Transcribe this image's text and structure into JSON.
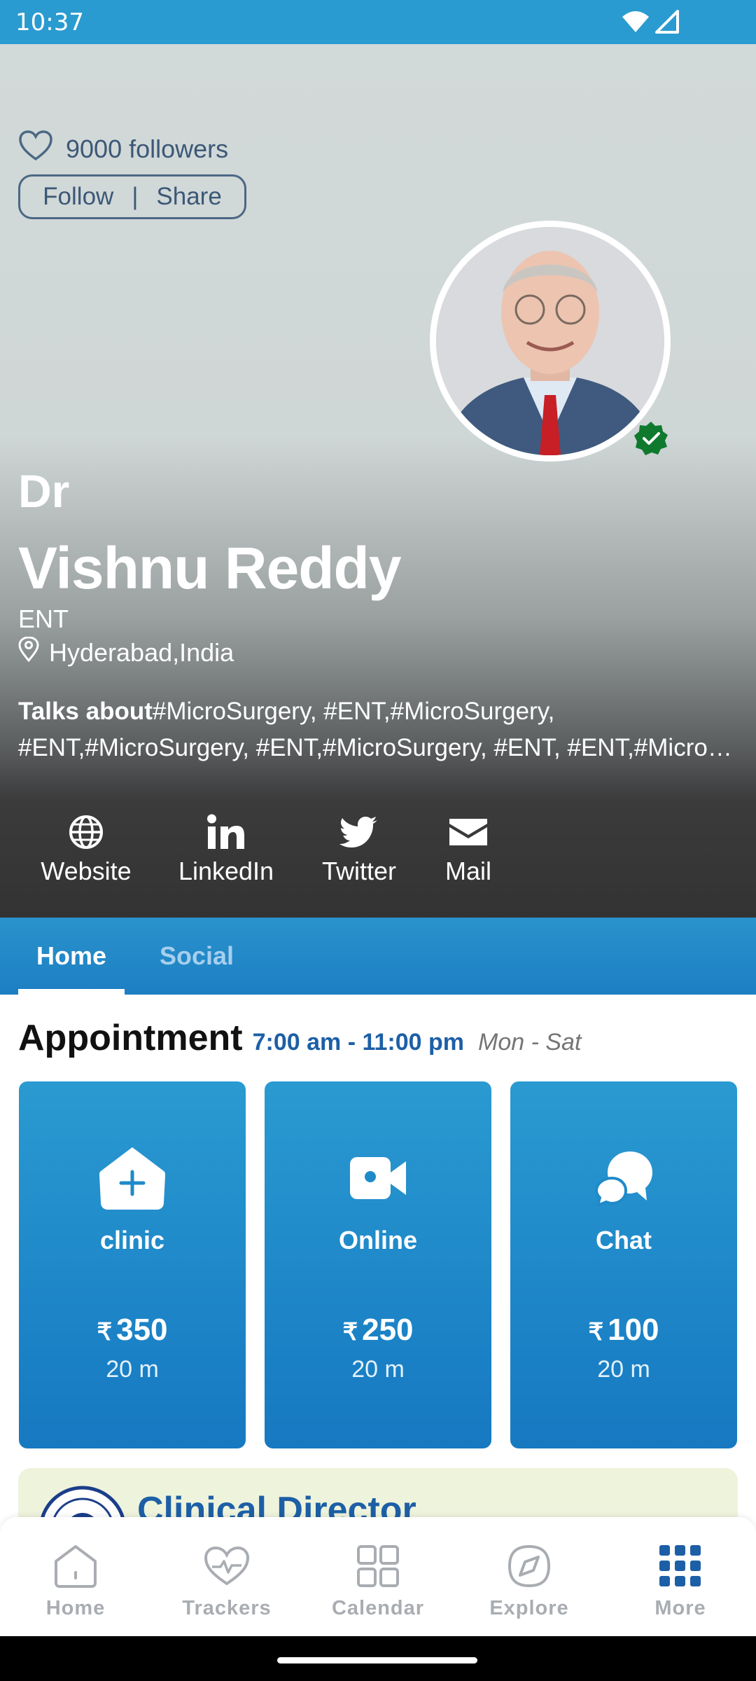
{
  "status": {
    "time": "10:37"
  },
  "profile": {
    "followers": "9000 followers",
    "follow_label": "Follow",
    "separator": "|",
    "share_label": "Share",
    "prefix": "Dr",
    "name": "Vishnu Reddy",
    "specialty": "ENT",
    "location": "Hyderabad,India",
    "talks_label": "Talks about",
    "talks_line1": "#MicroSurgery, #ENT,#MicroSurgery,",
    "talks_line2": "#ENT,#MicroSurgery, #ENT,#MicroSurgery, #ENT, #ENT,#MicroSurgery",
    "verified": true
  },
  "social_links": [
    {
      "label": "Website",
      "icon": "globe-icon"
    },
    {
      "label": "LinkedIn",
      "icon": "linkedin-icon"
    },
    {
      "label": "Twitter",
      "icon": "twitter-icon"
    },
    {
      "label": "Mail",
      "icon": "mail-icon"
    }
  ],
  "tabs": [
    {
      "label": "Home",
      "active": true
    },
    {
      "label": "Social",
      "active": false
    }
  ],
  "appointment": {
    "title": "Appointment",
    "hours": "7:00 am - 11:00 pm",
    "days": "Mon - Sat",
    "options": [
      {
        "name": "clinic",
        "currency": "₹",
        "price": "350",
        "duration": "20 m",
        "icon": "clinic-icon"
      },
      {
        "name": "Online",
        "currency": "₹",
        "price": "250",
        "duration": "20 m",
        "icon": "video-camera-icon"
      },
      {
        "name": "Chat",
        "currency": "₹",
        "price": "100",
        "duration": "20 m",
        "icon": "chat-bubbles-icon"
      }
    ]
  },
  "director_card": {
    "title": "Clinical Director"
  },
  "bottom_nav": [
    {
      "label": "Home",
      "icon": "home-icon"
    },
    {
      "label": "Trackers",
      "icon": "heart-pulse-icon"
    },
    {
      "label": "Calendar",
      "icon": "grid-icon"
    },
    {
      "label": "Explore",
      "icon": "compass-icon"
    },
    {
      "label": "More",
      "icon": "apps-grid-icon",
      "active": true
    }
  ],
  "colors": {
    "status_bar": "#2a9bd0",
    "tab_bar": "#1c7fc3",
    "card": "#1b82c6",
    "accent_text": "#1d5fa6",
    "verified_badge": "#0f7a2e"
  }
}
